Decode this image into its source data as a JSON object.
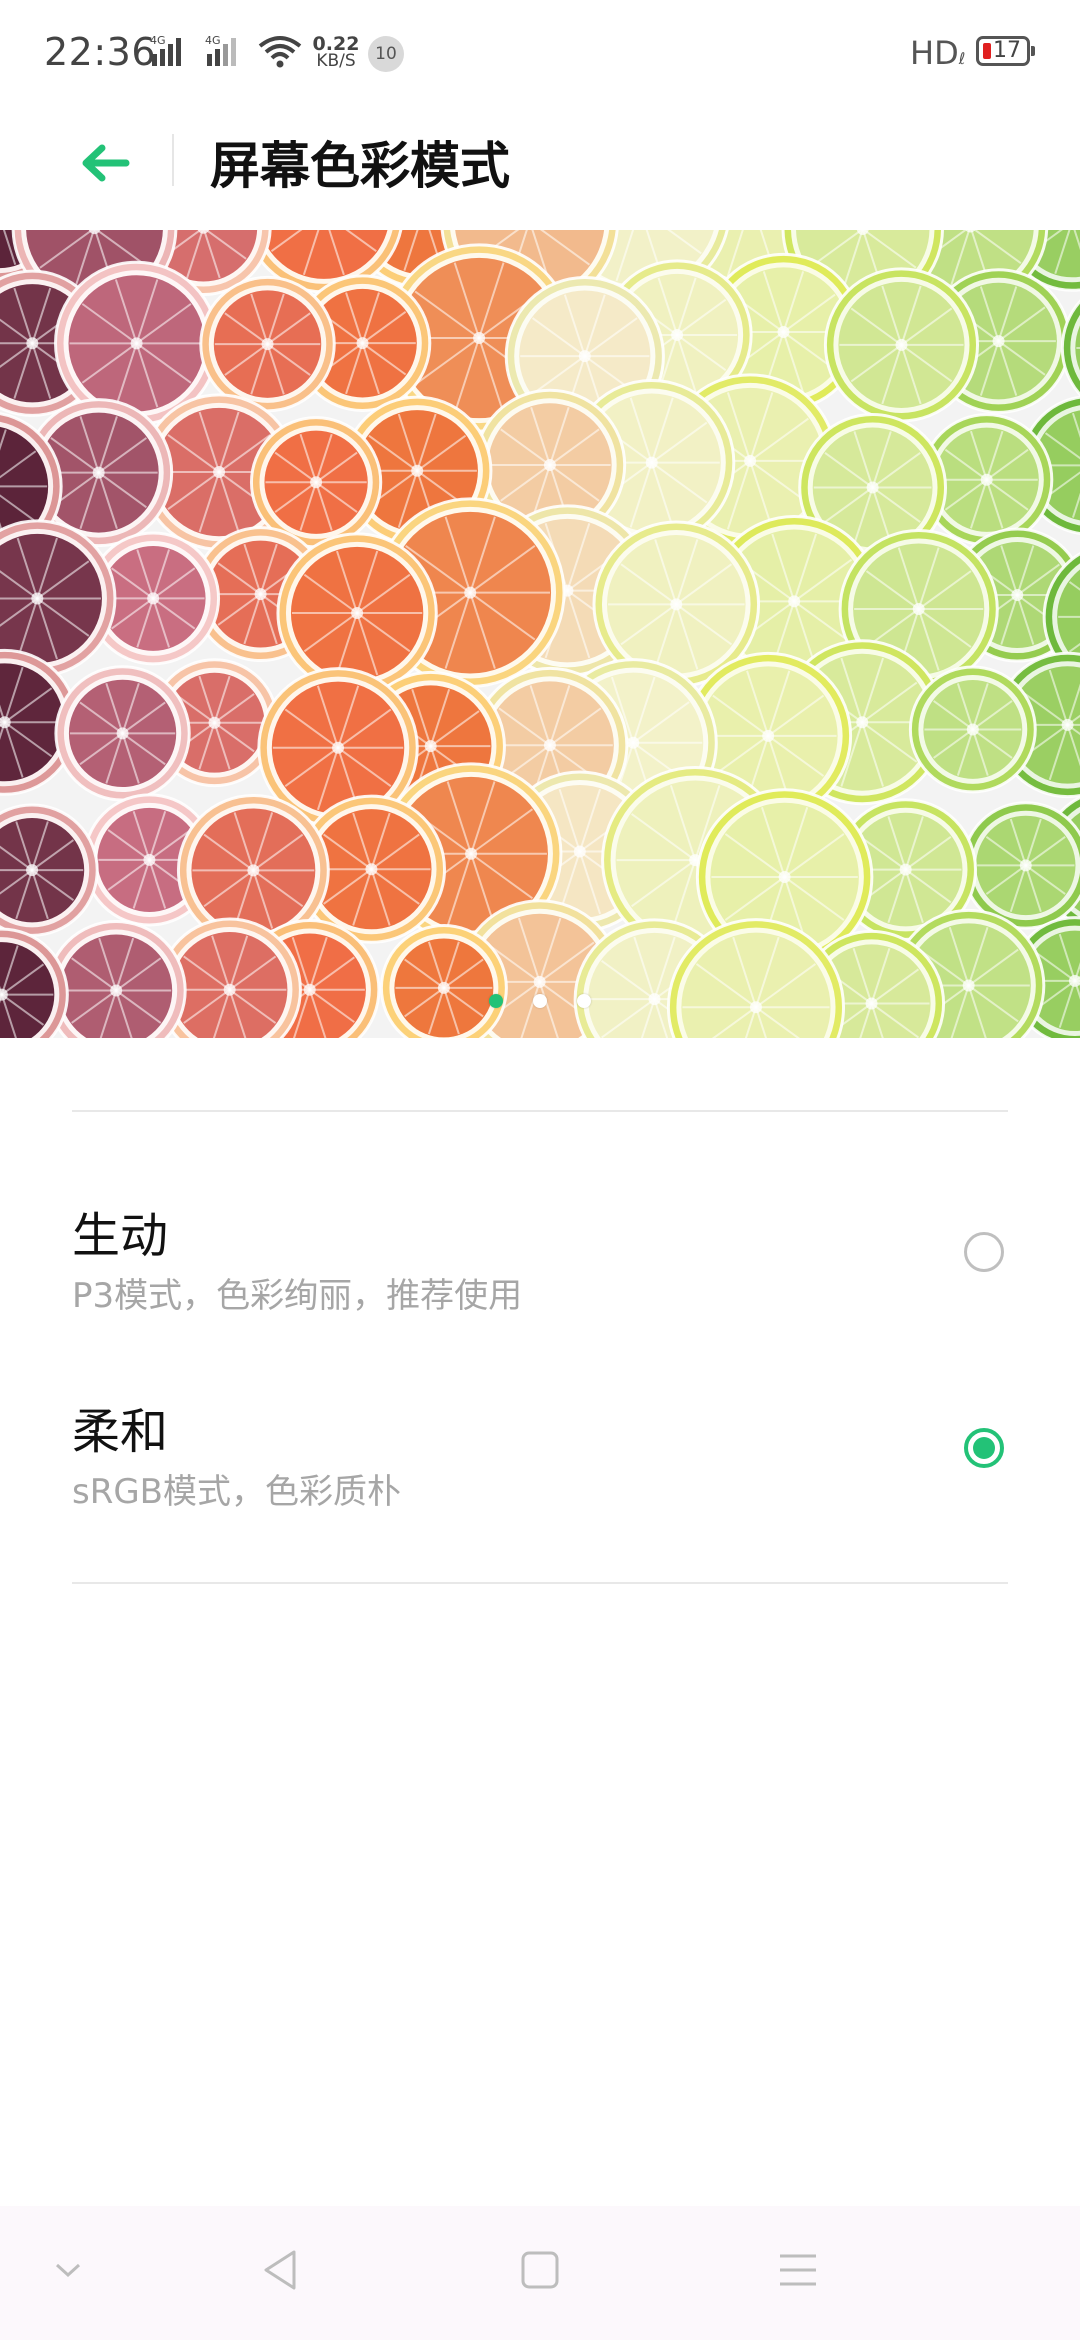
{
  "status_bar": {
    "time": "22:36",
    "network1": "4G",
    "network2": "4G",
    "speed_value": "0.22",
    "speed_unit": "KB/S",
    "notification_count": "10",
    "hd_label": "HD",
    "battery_level": "17",
    "battery_color": "#e02020"
  },
  "header": {
    "title": "屏幕色彩模式",
    "back_icon": "arrow-left-icon",
    "accent_color": "#23c277"
  },
  "banner": {
    "page_count": 3,
    "active_page": 1
  },
  "options": [
    {
      "title": "生动",
      "subtitle": "P3模式，色彩绚丽，推荐使用",
      "selected": false
    },
    {
      "title": "柔和",
      "subtitle": "sRGB模式，色彩质朴",
      "selected": true
    }
  ],
  "nav_bar": {
    "items": [
      "chevron-down-icon",
      "back-triangle-icon",
      "home-square-icon",
      "menu-icon"
    ]
  }
}
